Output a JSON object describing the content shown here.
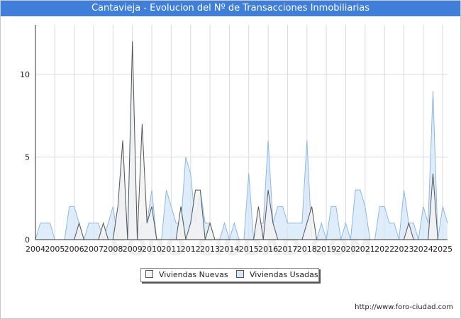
{
  "title": "Cantavieja - Evolucion del Nº de Transacciones Inmobiliarias",
  "footer_url": "http://www.foro-ciudad.com",
  "watermark": "FORO-CIUDAD.COM",
  "colors": {
    "title_bg": "#3f7fd9",
    "new_fill": "#f2f2f2",
    "new_line": "#555555",
    "used_fill": "#d4e6f8",
    "used_line": "#8cb8e8"
  },
  "chart_data": {
    "type": "area",
    "title": "Cantavieja - Evolucion del Nº de Transacciones Inmobiliarias",
    "xlabel": "",
    "ylabel": "",
    "xlim": [
      2004,
      2025.25
    ],
    "ylim": [
      0,
      13
    ],
    "x_ticks": [
      "2004",
      "2005",
      "2006",
      "2007",
      "2008",
      "2009",
      "2010",
      "2011",
      "2012",
      "2013",
      "2014",
      "2015",
      "2016",
      "2017",
      "2018",
      "2019",
      "2020",
      "2021",
      "2022",
      "2023",
      "2024",
      "2025"
    ],
    "y_ticks": [
      0,
      5,
      10
    ],
    "grid": true,
    "legend_position": "bottom-center",
    "x": [
      2004.0,
      2004.25,
      2004.5,
      2004.75,
      2005.0,
      2005.25,
      2005.5,
      2005.75,
      2006.0,
      2006.25,
      2006.5,
      2006.75,
      2007.0,
      2007.25,
      2007.5,
      2007.75,
      2008.0,
      2008.25,
      2008.5,
      2008.75,
      2009.0,
      2009.25,
      2009.5,
      2009.75,
      2010.0,
      2010.25,
      2010.5,
      2010.75,
      2011.0,
      2011.25,
      2011.5,
      2011.75,
      2012.0,
      2012.25,
      2012.5,
      2012.75,
      2013.0,
      2013.25,
      2013.5,
      2013.75,
      2014.0,
      2014.25,
      2014.5,
      2014.75,
      2015.0,
      2015.25,
      2015.5,
      2015.75,
      2016.0,
      2016.25,
      2016.5,
      2016.75,
      2017.0,
      2017.25,
      2017.5,
      2017.75,
      2018.0,
      2018.25,
      2018.5,
      2018.75,
      2019.0,
      2019.25,
      2019.5,
      2019.75,
      2020.0,
      2020.25,
      2020.5,
      2020.75,
      2021.0,
      2021.25,
      2021.5,
      2021.75,
      2022.0,
      2022.25,
      2022.5,
      2022.75,
      2023.0,
      2023.25,
      2023.5,
      2023.75,
      2024.0,
      2024.25,
      2024.5,
      2024.75,
      2025.0,
      2025.25
    ],
    "series": [
      {
        "name": "Viviendas Nuevas",
        "values": [
          0,
          0,
          0,
          0,
          0,
          0,
          0,
          0,
          0,
          1,
          0,
          0,
          0,
          0,
          1,
          0,
          0,
          2,
          6,
          0,
          12,
          0,
          7,
          1,
          2,
          0,
          0,
          0,
          0,
          0,
          2,
          0,
          1,
          3,
          3,
          0,
          1,
          0,
          0,
          0,
          0,
          0,
          0,
          0,
          0,
          0,
          2,
          0,
          3,
          1,
          0,
          0,
          0,
          0,
          0,
          0,
          1,
          2,
          0,
          0,
          0,
          0,
          0,
          0,
          0,
          0,
          0,
          0,
          0,
          0,
          0,
          0,
          0,
          0,
          0,
          0,
          0,
          1,
          0,
          0,
          0,
          0,
          4,
          0,
          0,
          0
        ]
      },
      {
        "name": "Viviendas Usadas",
        "values": [
          0,
          1,
          1,
          1,
          0,
          0,
          0,
          2,
          2,
          1,
          0,
          1,
          1,
          1,
          0,
          1,
          2,
          0,
          6,
          0,
          10,
          0,
          1,
          1,
          3,
          0,
          0,
          3,
          2,
          1,
          1,
          5,
          4,
          1,
          3,
          1,
          1,
          0,
          0,
          1,
          0,
          1,
          0,
          0,
          4,
          0,
          1,
          1,
          6,
          1,
          2,
          2,
          1,
          1,
          1,
          1,
          6,
          0,
          0,
          1,
          0,
          2,
          2,
          0,
          1,
          0,
          3,
          3,
          2,
          0,
          0,
          2,
          2,
          1,
          1,
          0,
          3,
          1,
          1,
          0,
          2,
          1,
          9,
          0,
          2,
          1
        ]
      }
    ]
  },
  "legend": {
    "new_label": "Viviendas Nuevas",
    "used_label": "Viviendas Usadas"
  }
}
